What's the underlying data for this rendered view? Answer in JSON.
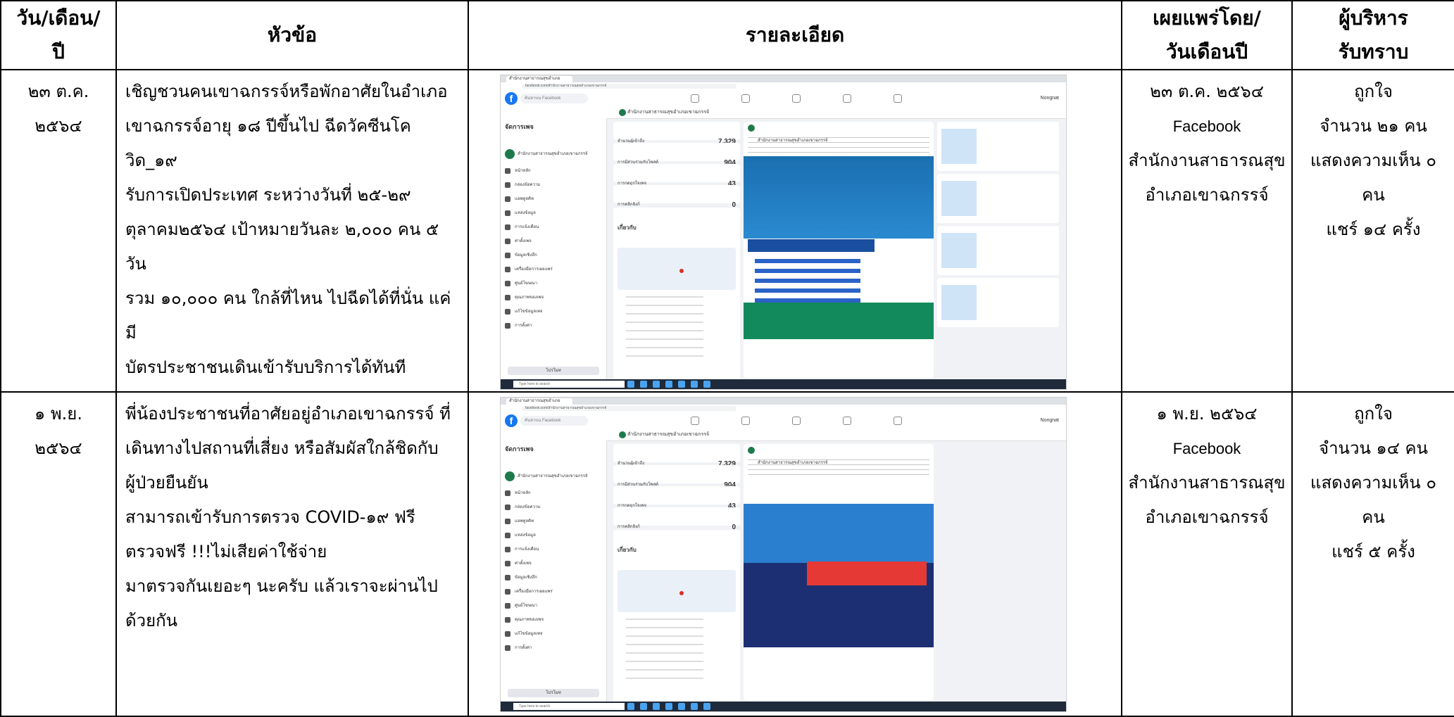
{
  "headers": {
    "date": [
      "วัน/เดือน/",
      "ปี"
    ],
    "topic": "หัวข้อ",
    "details": "รายละเอียด",
    "published": [
      "เผยแพร่โดย/",
      "วันเดือนปี"
    ],
    "acknowledged": [
      "ผู้บริหาร",
      "รับทราบ"
    ]
  },
  "rows": [
    {
      "date": [
        "๒๓ ต.ค.",
        "๒๕๖๔"
      ],
      "topic": [
        "เชิญชวนคนเขาฉกรรจ์หรือพักอาศัยในอำเภอ",
        "เขาฉกรรจ์อายุ ๑๘ ปีขึ้นไป ฉีดวัคซีนโควิด_๑๙",
        "รับการเปิดประเทศ ระหว่างวันที่ ๒๕-๒๙",
        "ตุลาคม๒๕๖๔ เป้าหมายวันละ ๒,๐๐๐ คน ๕ วัน",
        "รวม ๑๐,๐๐๐ คน ใกล้ที่ไหน ไปฉีดได้ที่นั่น แค่มี",
        "บัตรประชาชนเดินเข้ารับบริการได้ทันที"
      ],
      "screenshot": {
        "tab": "สำนักงานสาธารณสุขอำเภอ",
        "url": "facebook.com/สำนักงานสาธารณสุขอำเภอเขาฉกรรจ์",
        "search": "ค้นหาบน Facebook",
        "user": "Nongnat",
        "manage": "จัดการเพจ",
        "page_name": "สำนักงานสาธารณสุขอำเภอเขาฉกรรจ์",
        "stats": [
          {
            "label": "จำนวนผู้เข้าถึง",
            "value": "7,329"
          },
          {
            "label": "การมีส่วนร่วมกับโพสต์",
            "value": "904"
          },
          {
            "label": "การกดถูกใจเพจ",
            "value": "43"
          },
          {
            "label": "การคลิกลิงก์",
            "value": "0"
          }
        ],
        "about": "เกี่ยวกับ",
        "menu": [
          "หน้าหลัก",
          "กล่องข้อความ",
          "แอพทูลคิท",
          "แหล่งข้อมูล",
          "การแจ้งเตือน",
          "ค่าตั้งเพจ",
          "ข้อมูลเชิงลึก",
          "เครื่องมือการเผยแพร่",
          "ศูนย์โฆษณา",
          "คุณภาพของเพจ",
          "แก้ไขข้อมูลเพจ",
          "การตั้งค่า"
        ],
        "promote": "โปรโมท",
        "taskbar_search": "Type here to search"
      },
      "published": [
        "๒๓ ต.ค. ๒๕๖๔",
        "Facebook",
        "สำนักงานสาธารณสุข",
        "อำเภอเขาฉกรรจ์"
      ],
      "acknowledged": [
        "ถูกใจ",
        "จำนวน ๒๑ คน",
        "แสดงความเห็น ๐",
        "คน",
        "แชร์ ๑๔ ครั้ง"
      ]
    },
    {
      "date": [
        "๑ พ.ย.",
        "๒๕๖๔"
      ],
      "topic": [
        "พี่น้องประชาชนที่อาศัยอยู่อำเภอเขาฉกรรจ์ ที่",
        "เดินทางไปสถานที่เสี่ยง หรือสัมผัสใกล้ชิดกับ",
        "ผู้ป่วยยืนยัน",
        "สามารถเข้ารับการตรวจ COVID-๑๙ ฟรี",
        "ตรวจฟรี !!!ไม่เสียค่าใช้จ่าย",
        "มาตรวจกันเยอะๆ นะครับ แล้วเราจะผ่านไป",
        "ด้วยกัน"
      ],
      "screenshot": {
        "tab": "สำนักงานสาธารณสุขอำเภอ",
        "url": "facebook.com/สำนักงานสาธารณสุขอำเภอเขาฉกรรจ์",
        "search": "ค้นหาบน Facebook",
        "user": "Nongnat",
        "manage": "จัดการเพจ",
        "page_name": "สำนักงานสาธารณสุขอำเภอเขาฉกรรจ์",
        "stats": [
          {
            "label": "จำนวนผู้เข้าถึง",
            "value": "7,329"
          },
          {
            "label": "การมีส่วนร่วมกับโพสต์",
            "value": "904"
          },
          {
            "label": "การกดถูกใจเพจ",
            "value": "43"
          },
          {
            "label": "การคลิกลิงก์",
            "value": "0"
          }
        ],
        "about": "เกี่ยวกับ",
        "menu": [
          "หน้าหลัก",
          "กล่องข้อความ",
          "แอพทูลคิท",
          "แหล่งข้อมูล",
          "การแจ้งเตือน",
          "ค่าตั้งเพจ",
          "ข้อมูลเชิงลึก",
          "เครื่องมือการเผยแพร่",
          "ศูนย์โฆษณา",
          "คุณภาพของเพจ",
          "แก้ไขข้อมูลเพจ",
          "การตั้งค่า"
        ],
        "promote": "โปรโมท",
        "taskbar_search": "Type here to search"
      },
      "published": [
        "๑ พ.ย. ๒๕๖๔",
        "Facebook",
        "สำนักงานสาธารณสุข",
        "อำเภอเขาฉกรรจ์"
      ],
      "acknowledged": [
        "ถูกใจ",
        "จำนวน ๑๔ คน",
        "แสดงความเห็น ๐",
        "คน",
        "แชร์ ๕ ครั้ง"
      ]
    }
  ]
}
